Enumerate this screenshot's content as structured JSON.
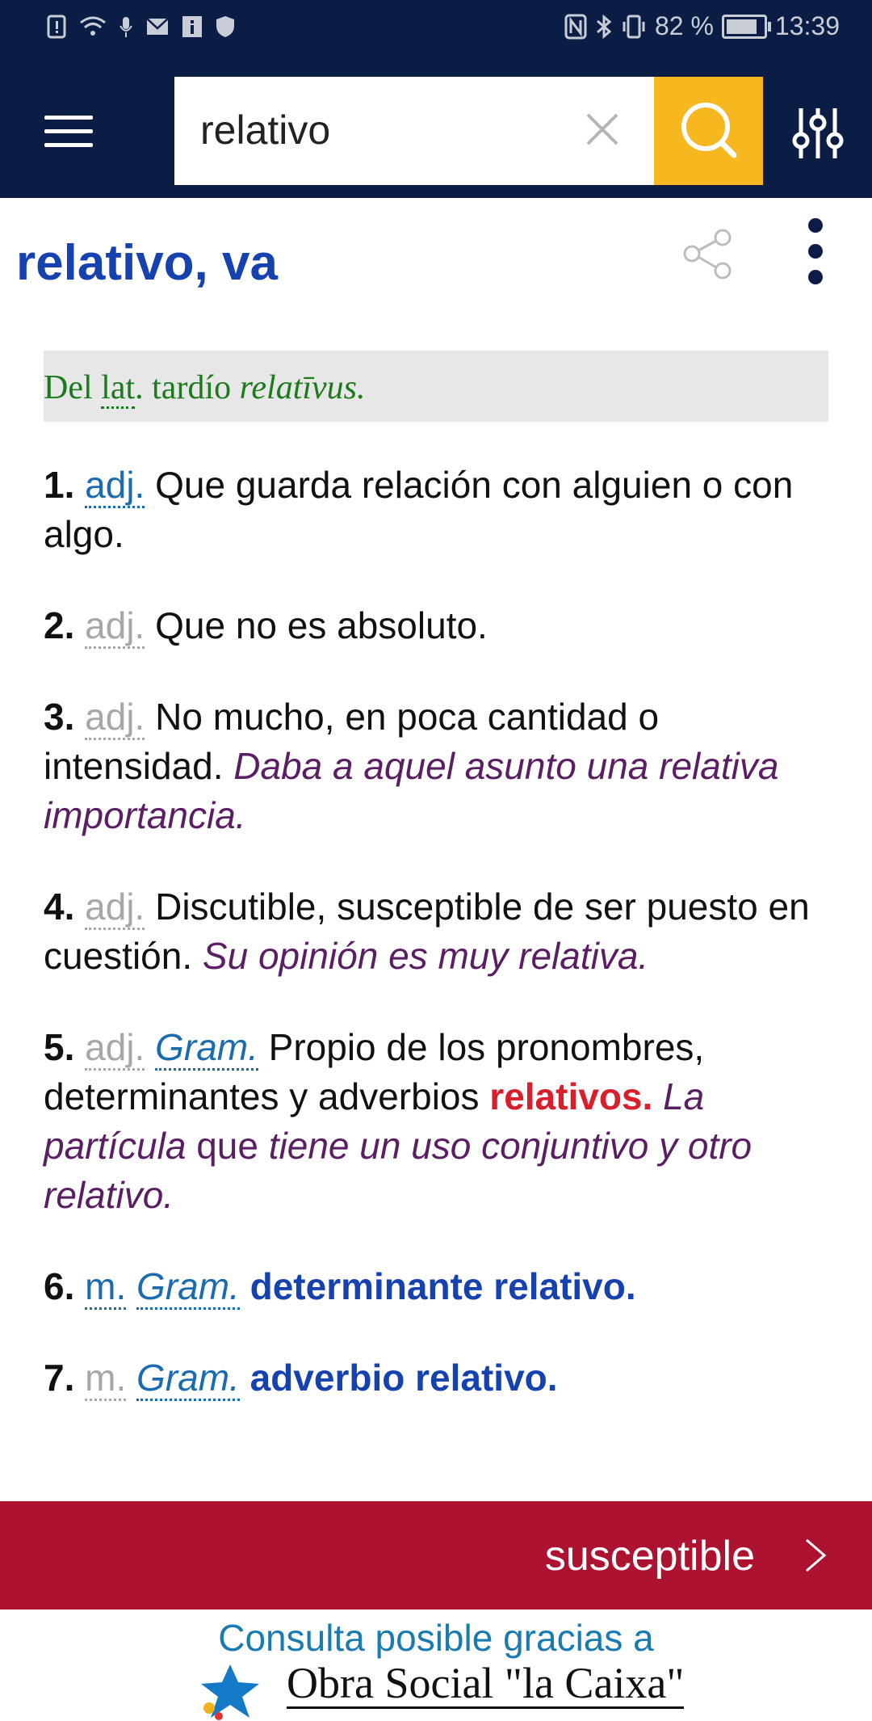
{
  "status_bar": {
    "battery_level": "82 %",
    "time": "13:39"
  },
  "search": {
    "query": "relativo"
  },
  "entry": {
    "title": "relativo, va",
    "etymology": {
      "prefix": "Del",
      "abbr": "lat",
      "after_abbr": ". tardío",
      "word": "relatīvus."
    },
    "definitions": [
      {
        "num": "1.",
        "abbr": "adj.",
        "text": "Que guarda relación con alguien o con algo."
      },
      {
        "num": "2.",
        "abbr": "adj.",
        "text": "Que no es absoluto."
      },
      {
        "num": "3.",
        "abbr": "adj.",
        "text": "No mucho, en poca cantidad o intensidad.",
        "example": "Daba a aquel asunto una relativa importancia."
      },
      {
        "num": "4.",
        "abbr": "adj.",
        "text": "Discutible, susceptible de ser puesto en cuestión.",
        "example": "Su opinión es muy relativa."
      },
      {
        "num": "5.",
        "abbr": "adj.",
        "abbr2": "Gram.",
        "text": "Propio de los pronombres, determinantes y adverbios",
        "red": "relativos.",
        "example_a": "La partícula",
        "example_mid": "que",
        "example_b": "tiene un uso conjuntivo y otro relativo."
      },
      {
        "num": "6.",
        "abbr": "m.",
        "abbr2": "Gram.",
        "link": "determinante relativo."
      },
      {
        "num": "7.",
        "abbr": "m.",
        "abbr2": "Gram.",
        "link": "adverbio relativo."
      }
    ]
  },
  "next": {
    "label": "susceptible"
  },
  "footer": {
    "caption": "Consulta posible gracias a",
    "sponsor": "Obra Social \"la Caixa\""
  },
  "colors": {
    "appbar": "#0b1d44",
    "search_button": "#f7b81f",
    "title": "#1642b0",
    "next_bar": "#ad1230"
  }
}
